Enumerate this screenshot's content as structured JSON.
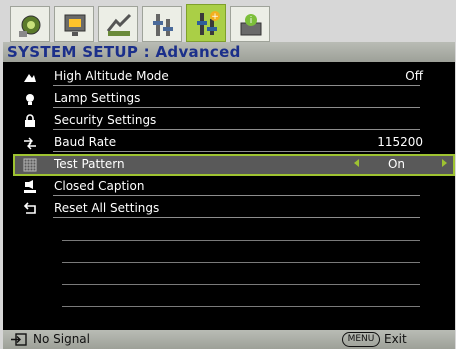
{
  "tabs": [
    {
      "name": "picture-icon"
    },
    {
      "name": "display-icon"
    },
    {
      "name": "settings-basic-icon"
    },
    {
      "name": "system-basic-icon"
    },
    {
      "name": "system-advanced-icon"
    },
    {
      "name": "information-icon"
    }
  ],
  "header": {
    "title": "SYSTEM SETUP : Advanced"
  },
  "menu": {
    "items": [
      {
        "label": "High Altitude Mode",
        "value": "Off",
        "icon": "mountain-icon"
      },
      {
        "label": "Lamp Settings",
        "value": "",
        "icon": "lamp-icon"
      },
      {
        "label": "Security Settings",
        "value": "",
        "icon": "lock-icon"
      },
      {
        "label": "Baud Rate",
        "value": "115200",
        "icon": "baud-rate-icon"
      },
      {
        "label": "Test Pattern",
        "value": "On",
        "icon": "test-pattern-icon"
      },
      {
        "label": "Closed Caption",
        "value": "",
        "icon": "closed-caption-icon"
      },
      {
        "label": "Reset All Settings",
        "value": "",
        "icon": "reset-icon"
      }
    ]
  },
  "footer": {
    "signal": "No Signal",
    "menu_button": "MENU",
    "exit_label": "Exit"
  },
  "colors": {
    "accent_green": "#9ec331",
    "header_text": "#1b2f8a",
    "panel_bg": "#000000"
  }
}
